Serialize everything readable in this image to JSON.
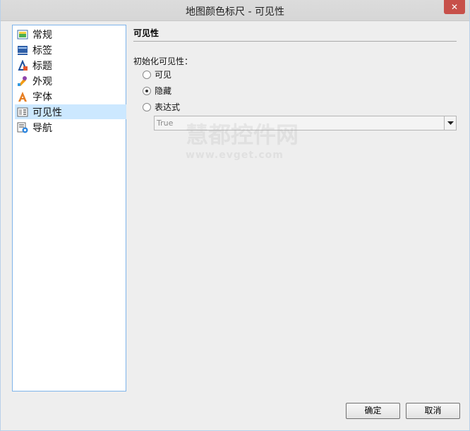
{
  "window": {
    "title": "地图颜色标尺 - 可见性",
    "close_glyph": "✕"
  },
  "sidebar": {
    "items": [
      {
        "label": "常规",
        "icon": "general-icon",
        "selected": false
      },
      {
        "label": "标签",
        "icon": "labels-icon",
        "selected": false
      },
      {
        "label": "标题",
        "icon": "title-icon",
        "selected": false
      },
      {
        "label": "外观",
        "icon": "appearance-icon",
        "selected": false
      },
      {
        "label": "字体",
        "icon": "font-icon",
        "selected": false
      },
      {
        "label": "可见性",
        "icon": "visibility-icon",
        "selected": true
      },
      {
        "label": "导航",
        "icon": "navigation-icon",
        "selected": false
      }
    ]
  },
  "main": {
    "section_title": "可见性",
    "init_label": "初始化可见性：",
    "options": [
      {
        "label": "可见",
        "checked": false
      },
      {
        "label": "隐藏",
        "checked": true
      },
      {
        "label": "表达式",
        "checked": false
      }
    ],
    "expression_value": "True"
  },
  "footer": {
    "ok_label": "确定",
    "cancel_label": "取消"
  },
  "watermark": {
    "text": "慧都控件网",
    "url": "www.evget.com"
  }
}
